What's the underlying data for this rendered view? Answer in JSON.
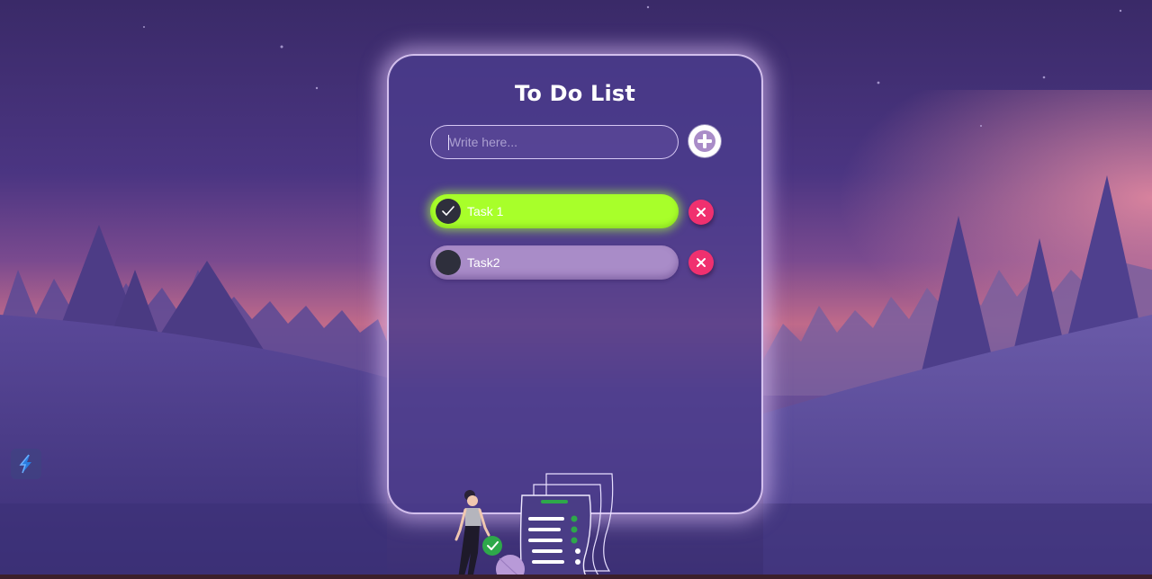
{
  "app": {
    "title": "To Do List"
  },
  "input": {
    "placeholder": "Write here...",
    "value": ""
  },
  "add_button": {
    "icon": "plus-circle-icon"
  },
  "tasks": [
    {
      "label": "Task 1",
      "done": true
    },
    {
      "label": "Task2",
      "done": false
    }
  ],
  "delete_button": {
    "icon": "close-icon"
  },
  "colors": {
    "card_border": "#ebd7ff",
    "task_done": "#a8ff2a",
    "task_pending": "#a98cc8",
    "delete": "#f0306f",
    "check_circle": "#2e2f3c",
    "accent_green": "#2ea84a"
  }
}
